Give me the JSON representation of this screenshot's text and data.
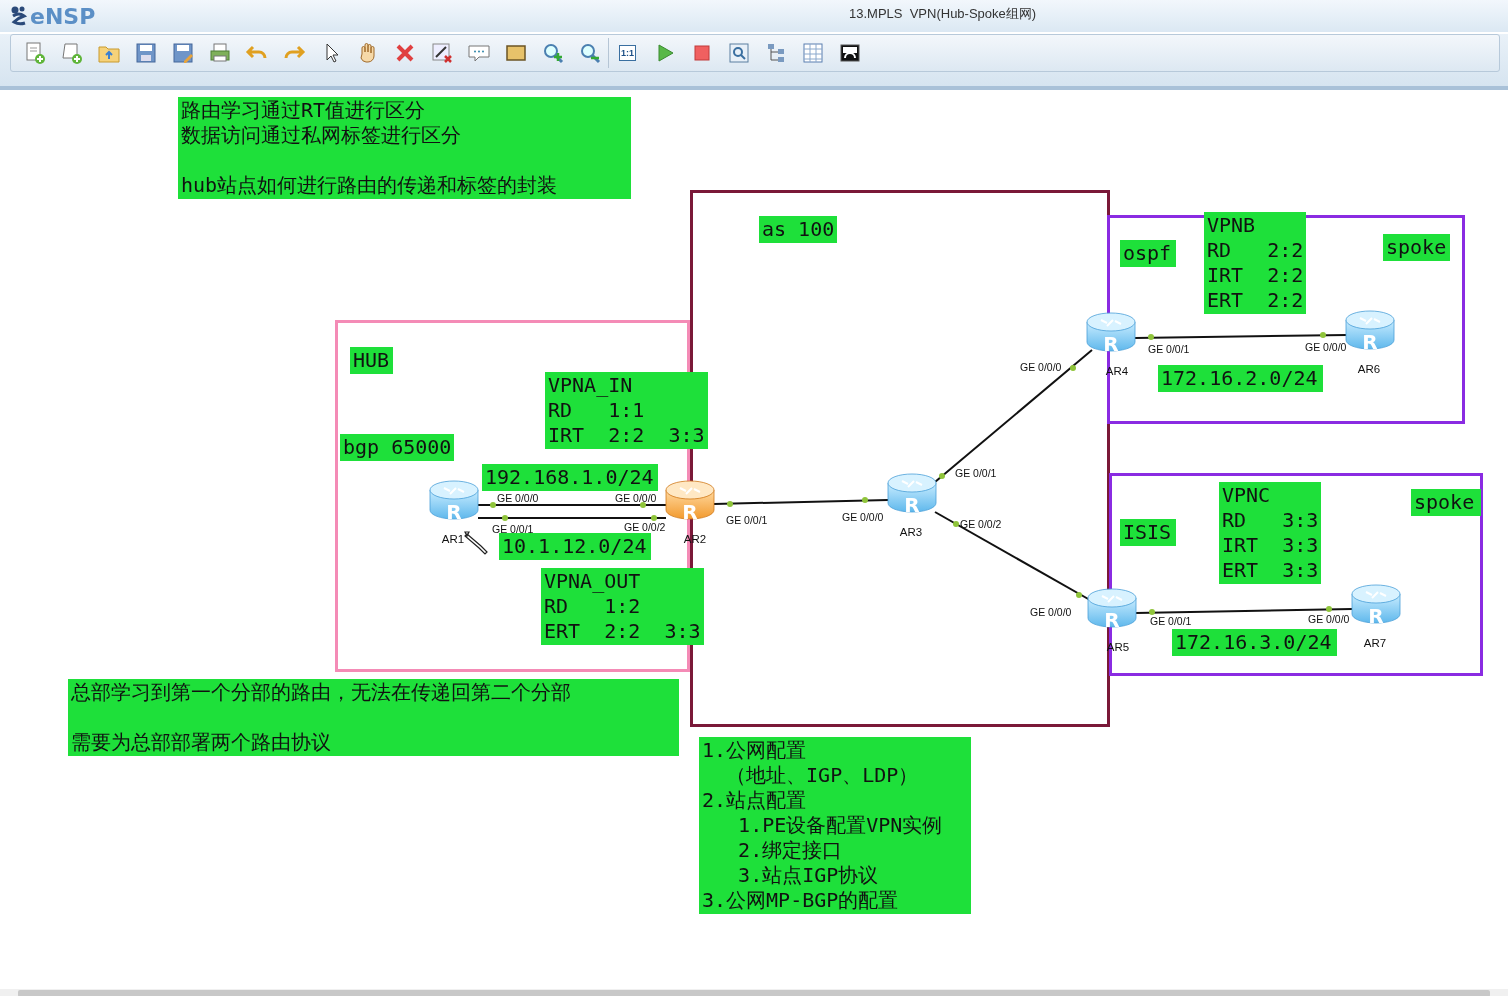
{
  "app": {
    "name": "eNSP",
    "title": "13.MPLS  VPN(Hub-Spoke组网)"
  },
  "toolbar": {
    "actual_size": "1:1"
  },
  "areas": [
    {
      "color": "#7a1838"
    },
    {
      "color": "#f48bb6"
    },
    {
      "color": "#8a2be2"
    },
    {
      "color": "#8a2be2"
    }
  ],
  "notes": [
    {
      "lines": [
        "路由学习通过RT值进行区分",
        "数据访问通过私网标签进行区分",
        "hub站点如何进行路由的传递和标签的封装"
      ]
    },
    {
      "text": "as 100"
    },
    {
      "text": "ospf"
    },
    {
      "text": "VPNB\nRD   2:2\nIRT  2:2\nERT  2:2"
    },
    {
      "text": "spoke"
    },
    {
      "text": "HUB"
    },
    {
      "text": "VPNA_IN\nRD   1:1\nIRT  2:2  3:3"
    },
    {
      "text": "bgp 65000"
    },
    {
      "text": "192.168.1.0/24"
    },
    {
      "text": "10.1.12.0/24"
    },
    {
      "text": "VPNA_OUT\nRD   1:2\nERT  2:2  3:3"
    },
    {
      "text": "172.16.2.0/24"
    },
    {
      "text": "ISIS"
    },
    {
      "text": "VPNC\nRD   3:3\nIRT  3:3\nERT  3:3"
    },
    {
      "text": "spoke"
    },
    {
      "text": "172.16.3.0/24"
    },
    {
      "lines": [
        "总部学习到第一个分部的路由，无法在传递回第二个分部",
        "需要为总部部署两个路由协议"
      ]
    },
    {
      "lines": [
        "1.公网配置",
        "  （地址、IGP、LDP）",
        "2.站点配置",
        "   1.PE设备配置VPN实例",
        "   2.绑定接口",
        "   3.站点IGP协议",
        "3.公网MP-BGP的配置"
      ]
    }
  ],
  "devices": [
    {
      "label": "AR1",
      "glyph": "R",
      "selected": false
    },
    {
      "label": "AR2",
      "glyph": "R",
      "selected": true
    },
    {
      "label": "AR3",
      "glyph": "R",
      "selected": false
    },
    {
      "label": "AR4",
      "glyph": "R",
      "selected": false
    },
    {
      "label": "AR5",
      "glyph": "R",
      "selected": false
    },
    {
      "label": "AR6",
      "glyph": "R",
      "selected": false
    },
    {
      "label": "AR7",
      "glyph": "R",
      "selected": false
    }
  ],
  "links": [
    {
      "ports": [
        "GE 0/0/0",
        "GE 0/0/0"
      ]
    },
    {
      "ports": [
        "GE 0/0/1",
        "GE 0/0/2"
      ]
    },
    {
      "ports": [
        "GE 0/0/1",
        "GE 0/0/0"
      ]
    },
    {
      "ports": [
        "GE 0/0/1",
        "GE 0/0/0"
      ]
    },
    {
      "ports": [
        "GE 0/0/2",
        "GE 0/0/0"
      ]
    },
    {
      "ports": [
        "GE 0/0/1",
        "GE 0/0/0"
      ]
    },
    {
      "ports": [
        "GE 0/0/1",
        "GE 0/0/0"
      ]
    }
  ]
}
